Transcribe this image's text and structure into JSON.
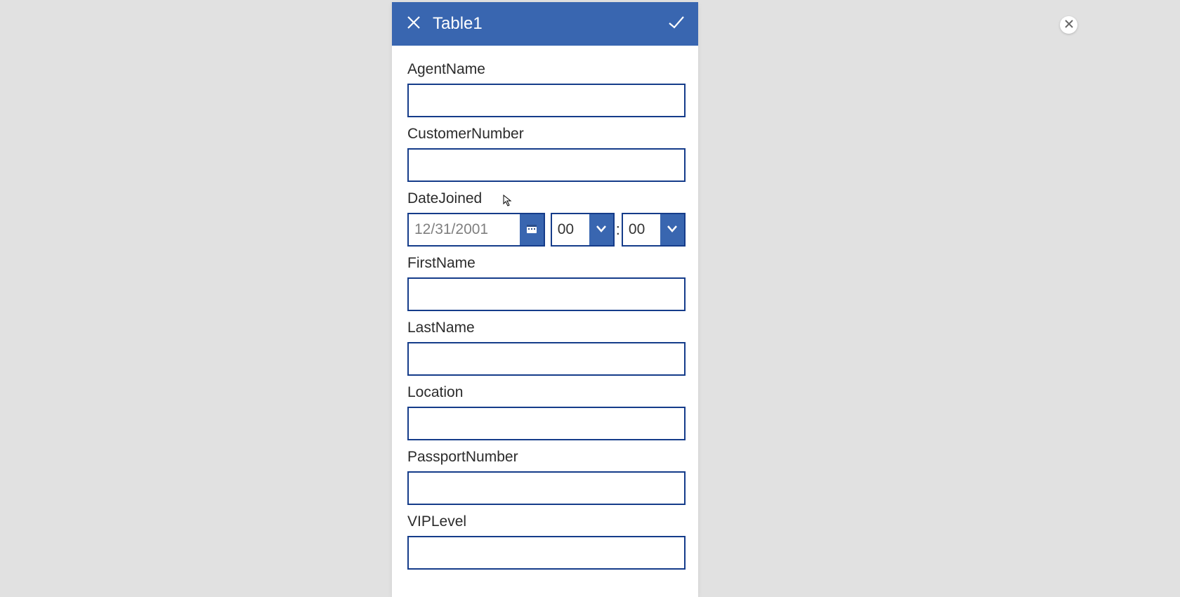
{
  "header": {
    "title": "Table1"
  },
  "fields": {
    "agentName": {
      "label": "AgentName",
      "value": ""
    },
    "customerNumber": {
      "label": "CustomerNumber",
      "value": ""
    },
    "dateJoined": {
      "label": "DateJoined",
      "date": "12/31/2001",
      "hour": "00",
      "minute": "00"
    },
    "firstName": {
      "label": "FirstName",
      "value": ""
    },
    "lastName": {
      "label": "LastName",
      "value": ""
    },
    "location": {
      "label": "Location",
      "value": ""
    },
    "passportNumber": {
      "label": "PassportNumber",
      "value": ""
    },
    "vipLevel": {
      "label": "VIPLevel",
      "value": ""
    }
  },
  "colors": {
    "brand": "#3966b0",
    "border": "#153c8a",
    "bg": "#e1e1e1"
  }
}
